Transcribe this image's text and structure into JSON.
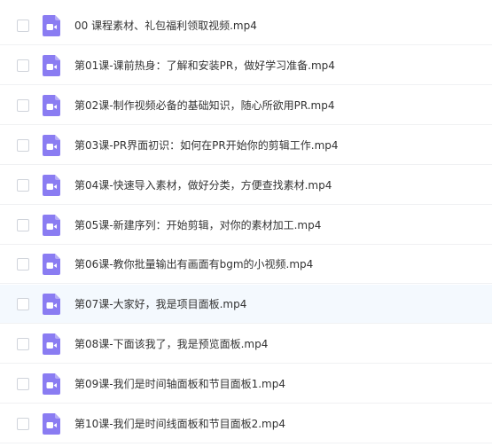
{
  "colors": {
    "icon_bg": "#8a7cf2",
    "icon_fold": "#b4aaf7",
    "icon_glyph": "#ffffff",
    "text": "#333333",
    "row_hover_bg": "#f4f9fe",
    "row_divider": "#f0f1f3",
    "checkbox_border": "#d0d4db"
  },
  "file_list": {
    "icon": "video-file-icon",
    "hovered_index": 7,
    "items": [
      {
        "name": "00 课程素材、礼包福利领取视频.mp4",
        "checked": false
      },
      {
        "name": "第01课-课前热身：了解和安装PR，做好学习准备.mp4",
        "checked": false
      },
      {
        "name": "第02课-制作视频必备的基础知识，随心所欲用PR.mp4",
        "checked": false
      },
      {
        "name": "第03课-PR界面初识：如何在PR开始你的剪辑工作.mp4",
        "checked": false
      },
      {
        "name": "第04课-快速导入素材，做好分类，方便查找素材.mp4",
        "checked": false
      },
      {
        "name": "第05课-新建序列：开始剪辑，对你的素材加工.mp4",
        "checked": false
      },
      {
        "name": "第06课-教你批量输出有画面有bgm的小视频.mp4",
        "checked": false
      },
      {
        "name": "第07课-大家好，我是项目面板.mp4",
        "checked": false
      },
      {
        "name": "第08课-下面该我了，我是预览面板.mp4",
        "checked": false
      },
      {
        "name": "第09课-我们是时间轴面板和节目面板1.mp4",
        "checked": false
      },
      {
        "name": "第10课-我们是时间线面板和节目面板2.mp4",
        "checked": false
      }
    ]
  }
}
